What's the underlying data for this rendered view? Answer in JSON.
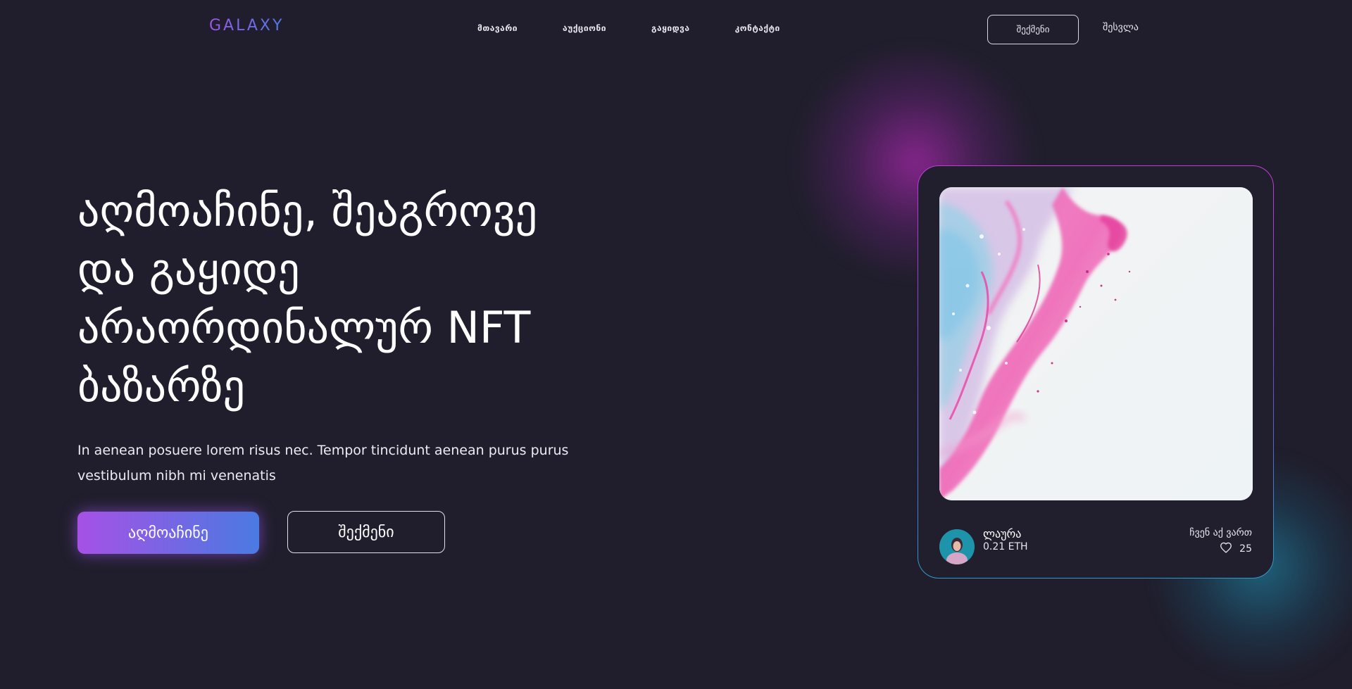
{
  "brand": {
    "logo": "GALAXY"
  },
  "nav": {
    "items": [
      "მთავარი",
      "აუქციონი",
      "გაყიდვა",
      "კონტაქტი"
    ],
    "register_label": "შექმენი",
    "login_label": "შესვლა"
  },
  "hero": {
    "title": "აღმოაჩინე, შეაგროვე და გაყიდე არაორდინალურ NFT ბაზარზე",
    "description": "In aenean posuere lorem risus nec. Tempor tincidunt aenean purus purus vestibulum nibh mi venenatis",
    "explore_label": "აღმოაჩინე",
    "create_label": "შექმენი"
  },
  "card": {
    "creator_name": "ლაურა",
    "price": "0.21 ETH",
    "bid_label": "ჩვენ აქ ვართ",
    "likes": "25",
    "icons": {
      "like": "heart-icon",
      "avatar": "avatar-photo"
    }
  },
  "colors": {
    "background": "#201e2c",
    "accent_purple": "#a651e6",
    "accent_blue": "#4a7ae2"
  }
}
